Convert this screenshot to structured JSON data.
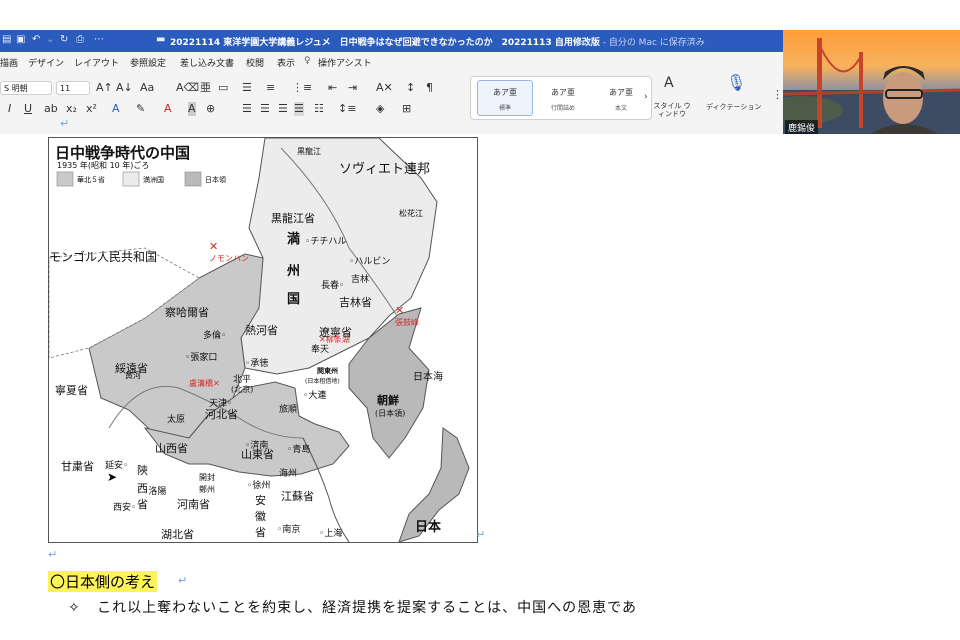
{
  "window": {
    "title": "20221114 東洋学園大学講義レジュメ　日中戦争はなぜ回避できなかったのか　20221113 自用修改版",
    "save_status": " - 自分の Mac に保存済み",
    "title_icons": [
      "sidebar-icon",
      "save-icon",
      "undo-icon",
      "redo-icon",
      "print-icon",
      "more-icon"
    ]
  },
  "ribbon": {
    "tabs": [
      "描画",
      "デザイン",
      "レイアウト",
      "参照設定",
      "差し込み文書",
      "校閲",
      "表示",
      "操作アシスト"
    ],
    "font_name": "S 明朝",
    "font_size": "11",
    "styles": [
      {
        "sample": "あア亜",
        "name": "標準"
      },
      {
        "sample": "あア亜",
        "name": "行間詰め"
      },
      {
        "sample": "あア亜",
        "name": "本文"
      }
    ],
    "style_pane": "スタイル ウィンドウ",
    "dictation": "ディクテーション"
  },
  "video": {
    "participant_name": "鹿錫俊"
  },
  "map": {
    "title": "日中戦争時代の中国",
    "subtitle": "1935 年(昭和 10 年)ごろ",
    "legend": [
      "華北５省",
      "満洲国",
      "日本領"
    ],
    "countries": {
      "ussr": "ソヴィエト連邦",
      "mongolia": "モンゴル人民共和国",
      "japan": "日本",
      "korea": "朝鮮",
      "korea_note": "(日本領)",
      "sea": "日本海"
    },
    "regions": {
      "manchukuo": [
        "満",
        "州",
        "国"
      ],
      "heilongjiang": "黒龍江省",
      "jilin": "吉林省",
      "liaoning": "遼寧省",
      "rehe": "熱河省",
      "chahar": "察哈爾省",
      "suiyuan": "綏遠省",
      "ningxia": "寧夏省",
      "gansu": "甘粛省",
      "shaanxi": [
        "陝",
        "西",
        "省"
      ],
      "shanxi": "山西省",
      "hebei": "河北省",
      "shandong": "山東省",
      "henan": "河南省",
      "jiangsu": "江蘇省",
      "anhui": [
        "安",
        "徽",
        "省"
      ],
      "hubei": "湖北省",
      "kwantung": "関東州",
      "kwantung_note": "(日本租借地)",
      "heihe": "黒龍江",
      "yellow_river": "黄河",
      "songhua": "松花江"
    },
    "cities": [
      "チチハル",
      "ハルビン",
      "長春",
      "吉林",
      "奉天",
      "大連",
      "旅順",
      "承徳",
      "北平",
      "(北京)",
      "天津",
      "多倫",
      "張家口",
      "太原",
      "済南",
      "青島",
      "徐州",
      "海州",
      "洛陽",
      "南京",
      "上海",
      "延安",
      "西安",
      "鄭州",
      "開封"
    ],
    "incidents": [
      "ノモンハン",
      "張鼓峰",
      "柳条湖",
      "盧溝橋"
    ]
  },
  "document": {
    "section_heading": "〇日本側の考え",
    "bullet_symbol": "✧",
    "bullet_text": "これ以上奪わないことを約束し、経済提携を提案することは、中国への恩恵であ",
    "return_mark": "↵"
  }
}
